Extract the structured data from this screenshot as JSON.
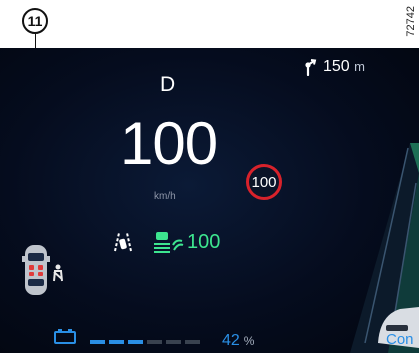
{
  "callout": {
    "number": "11"
  },
  "figure_ref": "72742",
  "navigation": {
    "distance": "150",
    "unit": "m"
  },
  "drive": {
    "gear": "D",
    "speed": "100",
    "speed_unit": "km/h",
    "speed_limit": "100"
  },
  "cruise": {
    "set_speed": "100"
  },
  "energy": {
    "percent": "42",
    "unit": "%",
    "level_fraction": 0.42
  },
  "side_panel": {
    "label": "Con"
  },
  "icons": {
    "navigation": "turn-right-arrow-icon",
    "lane_keep": "lane-keeping-assist-icon",
    "cruise": "adaptive-cruise-control-icon",
    "car": "vehicle-top-view-icon",
    "seatbelt": "seatbelt-warning-icon",
    "battery": "battery-icon"
  },
  "colors": {
    "background": "#050c1e",
    "accent_blue": "#2a8fe5",
    "accent_green": "#3de58f",
    "limit_red": "#d8222b",
    "warning_red": "#e03a3a"
  }
}
